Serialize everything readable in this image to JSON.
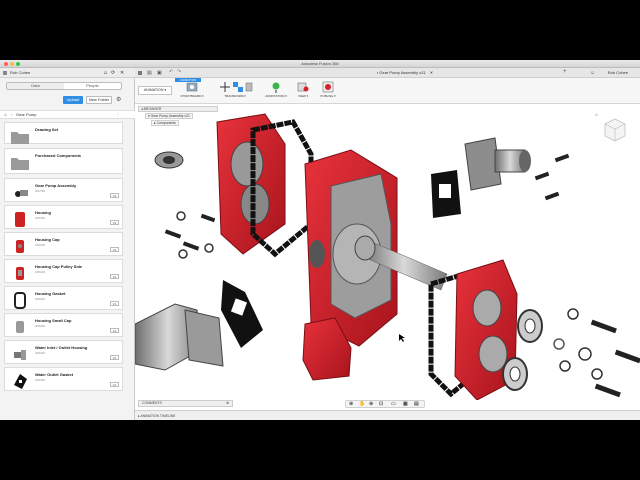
{
  "window": {
    "title": "Autodesk Fusion 360"
  },
  "data_panel": {
    "user": "Rob Cohee",
    "tabs": [
      {
        "label": "Data"
      },
      {
        "label": "People"
      }
    ],
    "upload_label": "Upload",
    "new_folder_label": "New Folder",
    "breadcrumb": "Gear Pump",
    "items": [
      {
        "name": "Drawing Set",
        "type": "folder"
      },
      {
        "name": "Purchased Components",
        "type": "folder"
      },
      {
        "name": "Gear Pump Assembly",
        "date": "3/27/20",
        "version": "V3"
      },
      {
        "name": "Housing",
        "date": "3/26/20",
        "version": "V3"
      },
      {
        "name": "Housing Cap",
        "date": "3/26/20",
        "version": "V2"
      },
      {
        "name": "Housing Cap Pulley Side",
        "date": "3/26/20",
        "version": "V2"
      },
      {
        "name": "Housing Gasket",
        "date": "3/26/20",
        "version": "V1"
      },
      {
        "name": "Housing Small Cap",
        "date": "3/26/20",
        "version": "V2"
      },
      {
        "name": "Water Inlet / Outlet Housing",
        "date": "3/26/20",
        "version": "V2"
      },
      {
        "name": "Water Outlet Gasket",
        "date": "3/26/20",
        "version": "V1"
      }
    ]
  },
  "document": {
    "tab_title": "Gear Pump Assembly v21",
    "user": "Rob Cohee",
    "workspace": "ANIMATION",
    "workspace_tab": "ANIMATION",
    "tools": [
      {
        "label": "STORYBOARD ▾"
      },
      {
        "label": "TRANSFORM ▾"
      },
      {
        "label": "ANNOTATION ▾"
      },
      {
        "label": "VIEW ▾"
      },
      {
        "label": "PUBLISH ▾"
      }
    ]
  },
  "browser": {
    "title": "BROWSER",
    "rows": [
      {
        "label": "Gear Pump Assembly v21"
      },
      {
        "label": "Components"
      }
    ]
  },
  "comments_label": "COMMENTS",
  "timeline_label": "ANIMATION TIMELINE",
  "colors": {
    "accent": "#2f8de4",
    "part_red": "#d6202a",
    "metal": "#9a9a9a"
  }
}
